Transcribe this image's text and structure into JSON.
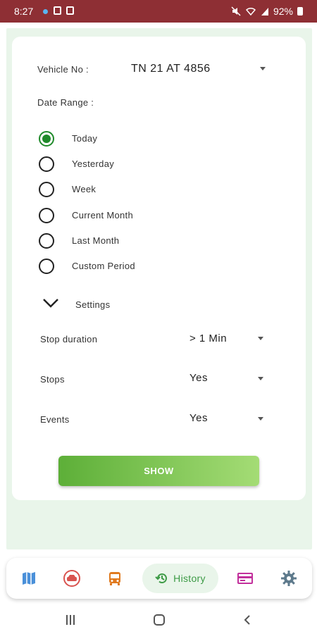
{
  "status_bar": {
    "time": "8:27",
    "battery": "92%"
  },
  "form": {
    "vehicle_label": "Vehicle No :",
    "vehicle_value": "TN 21 AT 4856",
    "date_range_label": "Date Range :",
    "date_options": [
      {
        "label": "Today",
        "selected": true
      },
      {
        "label": "Yesterday",
        "selected": false
      },
      {
        "label": "Week",
        "selected": false
      },
      {
        "label": "Current Month",
        "selected": false
      },
      {
        "label": "Last Month",
        "selected": false
      },
      {
        "label": "Custom Period",
        "selected": false
      }
    ],
    "settings_label": "Settings",
    "settings": [
      {
        "label": "Stop duration",
        "value": "> 1 Min"
      },
      {
        "label": "Stops",
        "value": "Yes"
      },
      {
        "label": "Events",
        "value": "Yes"
      }
    ],
    "show_button": "SHOW"
  },
  "bottom_nav": {
    "items": [
      {
        "icon": "map-icon"
      },
      {
        "icon": "car-icon"
      },
      {
        "icon": "bus-icon"
      },
      {
        "icon": "history-icon",
        "label": "History",
        "active": true
      },
      {
        "icon": "card-icon"
      },
      {
        "icon": "gear-icon"
      }
    ]
  },
  "colors": {
    "status_bar": "#8e2f34",
    "accent_green": "#1f8a2a",
    "panel_bg": "#e9f5ea",
    "button_gradient_start": "#5daf38",
    "button_gradient_end": "#a4dc75"
  }
}
